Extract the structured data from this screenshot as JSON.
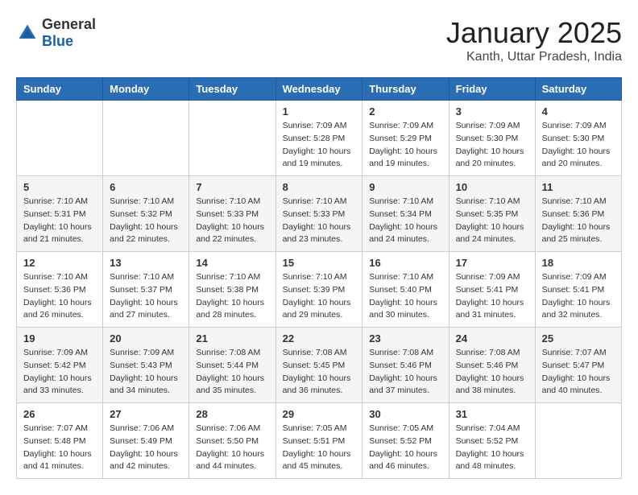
{
  "logo": {
    "general": "General",
    "blue": "Blue"
  },
  "title": "January 2025",
  "location": "Kanth, Uttar Pradesh, India",
  "weekdays": [
    "Sunday",
    "Monday",
    "Tuesday",
    "Wednesday",
    "Thursday",
    "Friday",
    "Saturday"
  ],
  "weeks": [
    [
      {
        "day": "",
        "info": ""
      },
      {
        "day": "",
        "info": ""
      },
      {
        "day": "",
        "info": ""
      },
      {
        "day": "1",
        "info": "Sunrise: 7:09 AM\nSunset: 5:28 PM\nDaylight: 10 hours\nand 19 minutes."
      },
      {
        "day": "2",
        "info": "Sunrise: 7:09 AM\nSunset: 5:29 PM\nDaylight: 10 hours\nand 19 minutes."
      },
      {
        "day": "3",
        "info": "Sunrise: 7:09 AM\nSunset: 5:30 PM\nDaylight: 10 hours\nand 20 minutes."
      },
      {
        "day": "4",
        "info": "Sunrise: 7:09 AM\nSunset: 5:30 PM\nDaylight: 10 hours\nand 20 minutes."
      }
    ],
    [
      {
        "day": "5",
        "info": "Sunrise: 7:10 AM\nSunset: 5:31 PM\nDaylight: 10 hours\nand 21 minutes."
      },
      {
        "day": "6",
        "info": "Sunrise: 7:10 AM\nSunset: 5:32 PM\nDaylight: 10 hours\nand 22 minutes."
      },
      {
        "day": "7",
        "info": "Sunrise: 7:10 AM\nSunset: 5:33 PM\nDaylight: 10 hours\nand 22 minutes."
      },
      {
        "day": "8",
        "info": "Sunrise: 7:10 AM\nSunset: 5:33 PM\nDaylight: 10 hours\nand 23 minutes."
      },
      {
        "day": "9",
        "info": "Sunrise: 7:10 AM\nSunset: 5:34 PM\nDaylight: 10 hours\nand 24 minutes."
      },
      {
        "day": "10",
        "info": "Sunrise: 7:10 AM\nSunset: 5:35 PM\nDaylight: 10 hours\nand 24 minutes."
      },
      {
        "day": "11",
        "info": "Sunrise: 7:10 AM\nSunset: 5:36 PM\nDaylight: 10 hours\nand 25 minutes."
      }
    ],
    [
      {
        "day": "12",
        "info": "Sunrise: 7:10 AM\nSunset: 5:36 PM\nDaylight: 10 hours\nand 26 minutes."
      },
      {
        "day": "13",
        "info": "Sunrise: 7:10 AM\nSunset: 5:37 PM\nDaylight: 10 hours\nand 27 minutes."
      },
      {
        "day": "14",
        "info": "Sunrise: 7:10 AM\nSunset: 5:38 PM\nDaylight: 10 hours\nand 28 minutes."
      },
      {
        "day": "15",
        "info": "Sunrise: 7:10 AM\nSunset: 5:39 PM\nDaylight: 10 hours\nand 29 minutes."
      },
      {
        "day": "16",
        "info": "Sunrise: 7:10 AM\nSunset: 5:40 PM\nDaylight: 10 hours\nand 30 minutes."
      },
      {
        "day": "17",
        "info": "Sunrise: 7:09 AM\nSunset: 5:41 PM\nDaylight: 10 hours\nand 31 minutes."
      },
      {
        "day": "18",
        "info": "Sunrise: 7:09 AM\nSunset: 5:41 PM\nDaylight: 10 hours\nand 32 minutes."
      }
    ],
    [
      {
        "day": "19",
        "info": "Sunrise: 7:09 AM\nSunset: 5:42 PM\nDaylight: 10 hours\nand 33 minutes."
      },
      {
        "day": "20",
        "info": "Sunrise: 7:09 AM\nSunset: 5:43 PM\nDaylight: 10 hours\nand 34 minutes."
      },
      {
        "day": "21",
        "info": "Sunrise: 7:08 AM\nSunset: 5:44 PM\nDaylight: 10 hours\nand 35 minutes."
      },
      {
        "day": "22",
        "info": "Sunrise: 7:08 AM\nSunset: 5:45 PM\nDaylight: 10 hours\nand 36 minutes."
      },
      {
        "day": "23",
        "info": "Sunrise: 7:08 AM\nSunset: 5:46 PM\nDaylight: 10 hours\nand 37 minutes."
      },
      {
        "day": "24",
        "info": "Sunrise: 7:08 AM\nSunset: 5:46 PM\nDaylight: 10 hours\nand 38 minutes."
      },
      {
        "day": "25",
        "info": "Sunrise: 7:07 AM\nSunset: 5:47 PM\nDaylight: 10 hours\nand 40 minutes."
      }
    ],
    [
      {
        "day": "26",
        "info": "Sunrise: 7:07 AM\nSunset: 5:48 PM\nDaylight: 10 hours\nand 41 minutes."
      },
      {
        "day": "27",
        "info": "Sunrise: 7:06 AM\nSunset: 5:49 PM\nDaylight: 10 hours\nand 42 minutes."
      },
      {
        "day": "28",
        "info": "Sunrise: 7:06 AM\nSunset: 5:50 PM\nDaylight: 10 hours\nand 44 minutes."
      },
      {
        "day": "29",
        "info": "Sunrise: 7:05 AM\nSunset: 5:51 PM\nDaylight: 10 hours\nand 45 minutes."
      },
      {
        "day": "30",
        "info": "Sunrise: 7:05 AM\nSunset: 5:52 PM\nDaylight: 10 hours\nand 46 minutes."
      },
      {
        "day": "31",
        "info": "Sunrise: 7:04 AM\nSunset: 5:52 PM\nDaylight: 10 hours\nand 48 minutes."
      },
      {
        "day": "",
        "info": ""
      }
    ]
  ]
}
